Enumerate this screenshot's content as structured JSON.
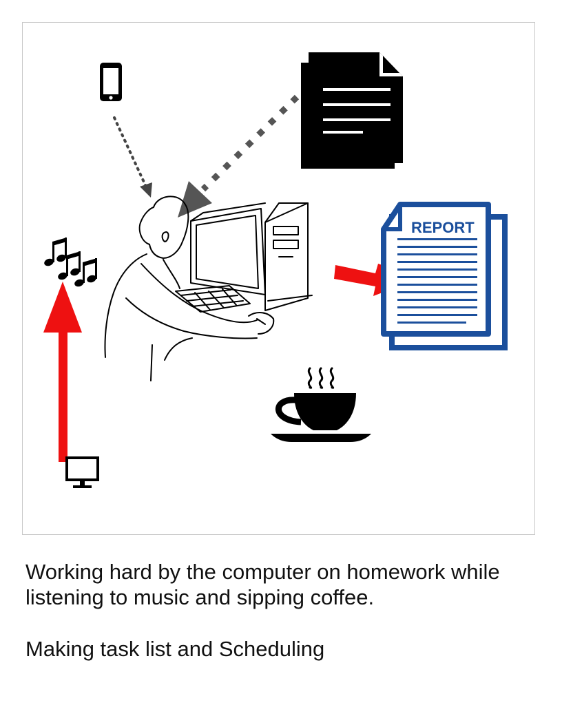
{
  "illustration": {
    "report_label": "REPORT",
    "icons": [
      "phone-icon",
      "document-icon",
      "music-notes-icon",
      "person-at-computer",
      "report-icon",
      "coffee-cup-icon",
      "monitor-icon"
    ],
    "colors": {
      "arrow_red": "#ee1111",
      "arrow_gray": "#555555",
      "report_blue": "#1b4f9c",
      "ink": "#000000"
    }
  },
  "caption": {
    "line1": "Working hard by the computer on homework while",
    "line2": "listening to music and sipping coffee.",
    "subtitle": "Making task list and Scheduling"
  }
}
